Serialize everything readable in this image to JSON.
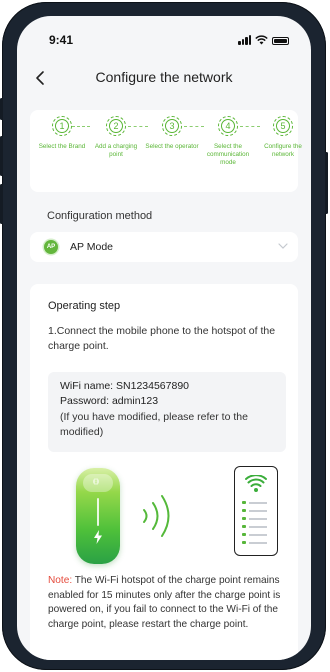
{
  "status_bar": {
    "time": "9:41"
  },
  "nav": {
    "title": "Configure the network"
  },
  "steps": [
    {
      "number": "1",
      "label": "Select the Brand"
    },
    {
      "number": "2",
      "label": "Add a charging point"
    },
    {
      "number": "3",
      "label": "Select the operator"
    },
    {
      "number": "4",
      "label": "Select the communication mode"
    },
    {
      "number": "5",
      "label": "Configure the network"
    }
  ],
  "config": {
    "section_label": "Configuration method",
    "icon_text": "AP",
    "selected_method": "AP Mode"
  },
  "operating": {
    "title": "Operating step",
    "step_text": "1.Connect the mobile phone to the hotspot of the charge point.",
    "wifi_name_label": "WiFi name:",
    "wifi_name_value": "SN1234567890",
    "password_label": "Password:",
    "password_value": "admin123",
    "modified_note": "(If you have modified, please refer to the modified)"
  },
  "note": {
    "label": "Note:",
    "text": " The Wi-Fi hotspot of the charge point remains enabled for 15 minutes only after the charge point is powered on, if you fail to connect to the Wi-Fi of the charge point, please restart the charge point."
  },
  "colors": {
    "accent": "#59b635",
    "note_red": "#e54b3c",
    "frame": "#1b2430",
    "background": "#f5f6f8"
  },
  "icons": [
    "back-arrow-icon",
    "signal-icon",
    "wifi-icon",
    "battery-icon",
    "chevron-down-icon",
    "ap-mode-icon",
    "charger-illustration",
    "wireless-waves-icon",
    "phone-wifi-illustration"
  ]
}
